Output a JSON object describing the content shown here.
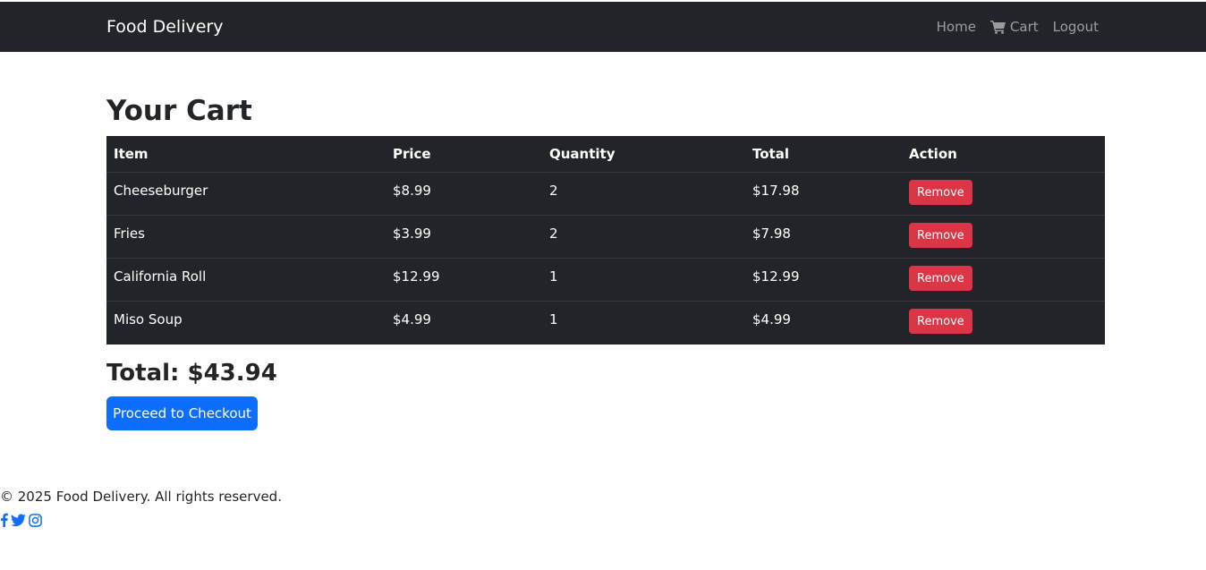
{
  "navbar": {
    "brand": "Food Delivery",
    "links": [
      {
        "label": "Home",
        "icon": ""
      },
      {
        "label": "Cart",
        "icon": "cart-icon"
      },
      {
        "label": "Logout",
        "icon": ""
      }
    ]
  },
  "page": {
    "heading": "Your Cart"
  },
  "cart": {
    "columns": [
      "Item",
      "Price",
      "Quantity",
      "Total",
      "Action"
    ],
    "rows": [
      {
        "item": "Cheeseburger",
        "price": "$8.99",
        "quantity": "2",
        "total": "$17.98",
        "action": "Remove"
      },
      {
        "item": "Fries",
        "price": "$3.99",
        "quantity": "2",
        "total": "$7.98",
        "action": "Remove"
      },
      {
        "item": "California Roll",
        "price": "$12.99",
        "quantity": "1",
        "total": "$12.99",
        "action": "Remove"
      },
      {
        "item": "Miso Soup",
        "price": "$4.99",
        "quantity": "1",
        "total": "$4.99",
        "action": "Remove"
      }
    ],
    "total_text": "Total: $43.94",
    "checkout_label": "Proceed to Checkout"
  },
  "footer": {
    "copyright": "© 2025 Food Delivery. All rights reserved.",
    "social_icons": [
      "facebook-icon",
      "twitter-icon",
      "instagram-icon"
    ]
  },
  "colors": {
    "navbar_bg": "#212529",
    "danger": "#dc3545",
    "primary": "#0d6efd"
  }
}
